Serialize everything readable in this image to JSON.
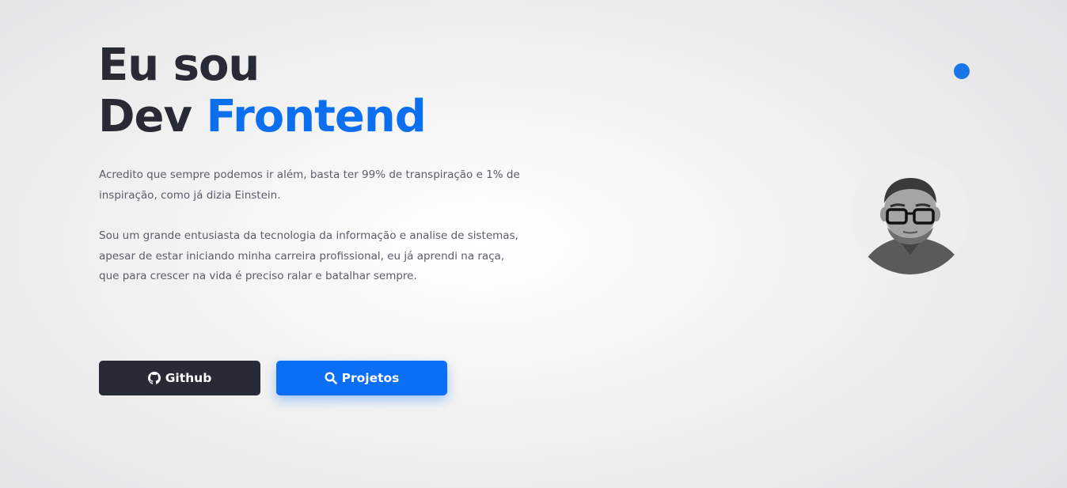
{
  "hero": {
    "line1": "Eu sou",
    "line2_prefix": "Dev",
    "line2_accent": "Frontend"
  },
  "intro": {
    "paragraph1": "Acredito que sempre podemos ir além, basta ter 99% de transpiração e 1% de inspiração, como já dizia Einstein.",
    "paragraph2": "Sou um grande entusiasta da tecnologia da informação e analise de sistemas, apesar de estar iniciando minha carreira profissional, eu já aprendi na raça, que para crescer na vida é preciso ralar e batalhar sempre."
  },
  "buttons": {
    "github_label": "Github",
    "github_icon": "github-icon",
    "projects_label": "Projetos",
    "projects_icon": "search-icon"
  },
  "colors": {
    "accent": "#0b6ff0",
    "dark": "#282a36",
    "text": "#5b5d68"
  }
}
